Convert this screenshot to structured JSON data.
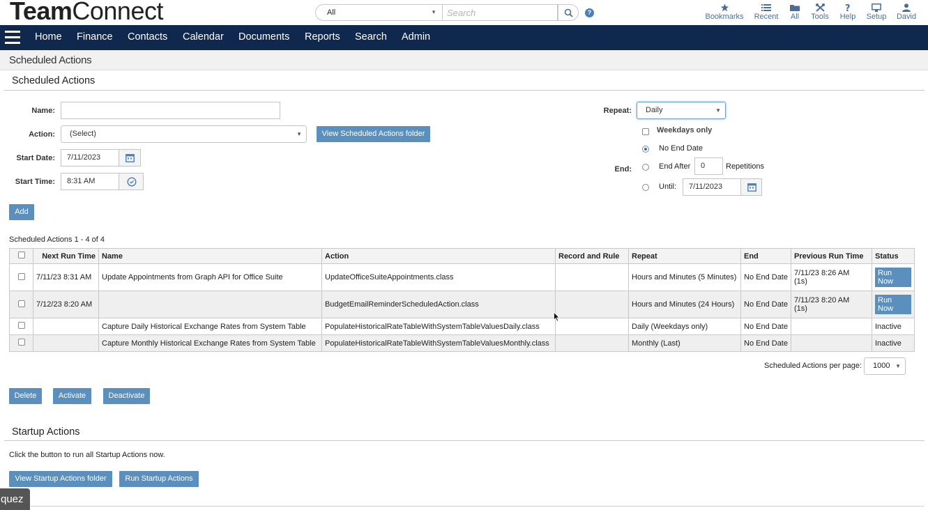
{
  "header": {
    "logo_bold": "Team",
    "logo_rest": "Connect",
    "search_scope": "All",
    "search_placeholder": "Search",
    "help_glyph": "?",
    "nav": [
      {
        "label": "Bookmarks",
        "icon": "star-icon"
      },
      {
        "label": "Recent",
        "icon": "list-icon"
      },
      {
        "label": "All",
        "icon": "folder-icon"
      },
      {
        "label": "Tools",
        "icon": "tools-icon"
      },
      {
        "label": "Help",
        "icon": "question-icon"
      },
      {
        "label": "Setup",
        "icon": "monitor-icon"
      },
      {
        "label": "David",
        "icon": "user-icon"
      }
    ],
    "accent": "#4a6e98"
  },
  "navbar": {
    "background": "#10284d",
    "items": [
      "Home",
      "Finance",
      "Contacts",
      "Calendar",
      "Documents",
      "Reports",
      "Search",
      "Admin"
    ]
  },
  "page": {
    "title": "Scheduled Actions"
  },
  "form": {
    "section_title": "Scheduled Actions",
    "name_label": "Name:",
    "name_value": "",
    "action_label": "Action:",
    "action_value": "(Select)",
    "view_folder_button": "View Scheduled Actions folder",
    "start_date_label": "Start Date:",
    "start_date_value": "7/11/2023",
    "start_time_label": "Start Time:",
    "start_time_value": "8:31 AM",
    "add_button": "Add",
    "repeat_label": "Repeat:",
    "repeat_value": "Daily",
    "weekdays_only_label": "Weekdays only",
    "end_label": "End:",
    "no_end_date_label": "No End Date",
    "end_after_label": "End After",
    "end_after_value": "0",
    "repetitions_label": "Repetitions",
    "until_label": "Until:",
    "until_value": "7/11/2023"
  },
  "table": {
    "count_text": "Scheduled Actions 1 - 4 of 4",
    "columns": [
      "Next Run Time",
      "Name",
      "Action",
      "Record and Rule",
      "Repeat",
      "End",
      "Previous Run Time",
      "Status"
    ],
    "rows": [
      {
        "next_run": "7/11/23 8:31 AM",
        "name": "Update Appointments from Graph API for Office Suite",
        "action": "UpdateOfficeSuiteAppointments.class",
        "record_rule": "",
        "repeat": "Hours and Minutes (5 Minutes)",
        "end": "No End Date",
        "prev_run": "7/11/23 8:26 AM",
        "prev_run_dur": "(1s)",
        "status": "Run Now"
      },
      {
        "next_run": "7/12/23 8:20 AM",
        "name": "",
        "action": "BudgetEmailReminderScheduledAction.class",
        "record_rule": "",
        "repeat": "Hours and Minutes (24 Hours)",
        "end": "No End Date",
        "prev_run": "7/11/23 8:20 AM",
        "prev_run_dur": "(1s)",
        "status": "Run Now"
      },
      {
        "next_run": "",
        "name": "Capture Daily Historical Exchange Rates from System Table",
        "action": "PopulateHistoricalRateTableWithSystemTableValuesDaily.class",
        "record_rule": "",
        "repeat": "Daily (Weekdays only)",
        "end": "No End Date",
        "prev_run": "",
        "prev_run_dur": "",
        "status": "Inactive"
      },
      {
        "next_run": "",
        "name": "Capture Monthly Historical Exchange Rates from System Table",
        "action": "PopulateHistoricalRateTableWithSystemTableValuesMonthly.class",
        "record_rule": "",
        "repeat": "Monthly (Last)",
        "end": "No End Date",
        "prev_run": "",
        "prev_run_dur": "",
        "status": "Inactive"
      }
    ],
    "per_page_label": "Scheduled Actions per page:",
    "per_page_value": "1000",
    "delete_button": "Delete",
    "activate_button": "Activate",
    "deactivate_button": "Deactivate"
  },
  "startup": {
    "section_title": "Startup Actions",
    "description": "Click the button to run all Startup Actions now.",
    "view_folder_button": "View Startup Actions folder",
    "run_button": "Run Startup Actions"
  },
  "overlay": {
    "badge_text": "quez"
  },
  "colors": {
    "button": "#5b8fbd",
    "radio_selected": "#2a6fc9"
  }
}
